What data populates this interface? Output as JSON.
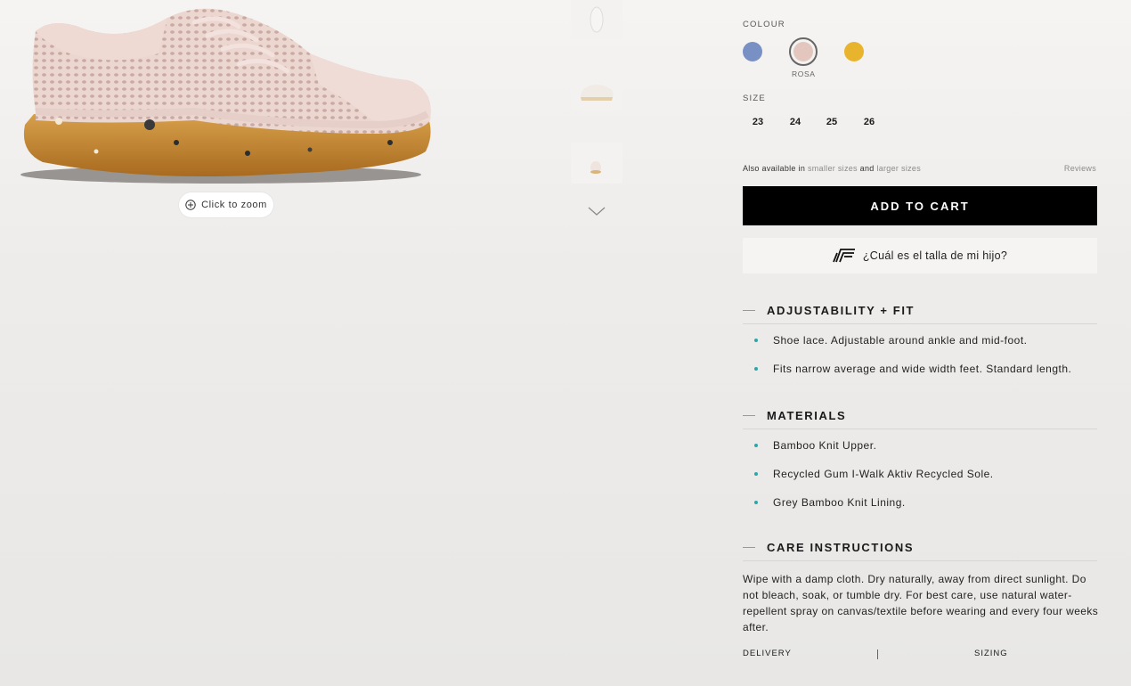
{
  "gallery": {
    "zoom_label": "Click to zoom"
  },
  "options": {
    "colour_label": "COLOUR",
    "colours": [
      {
        "name": "",
        "hex": "#7890c4"
      },
      {
        "name": "ROSA",
        "hex": "#e3c7bf",
        "selected": true
      },
      {
        "name": "",
        "hex": "#e9b42d"
      }
    ],
    "size_label": "SIZE",
    "sizes": [
      "23",
      "24",
      "25",
      "26"
    ]
  },
  "availability": {
    "prefix": "Also available in ",
    "smaller": "smaller sizes",
    "and": " and ",
    "larger": "larger sizes",
    "reviews": "Reviews"
  },
  "cta": {
    "add_to_cart": "ADD TO CART",
    "fit_finder": "¿Cuál es el talla de mi hijo?"
  },
  "sections": {
    "adjustability": {
      "title": "ADJUSTABILITY + FIT",
      "items": [
        "Shoe lace. Adjustable around ankle and mid-foot.",
        "Fits narrow average and wide width feet. Standard length."
      ]
    },
    "materials": {
      "title": "MATERIALS",
      "items": [
        "Bamboo Knit Upper.",
        "Recycled Gum I-Walk Aktiv Recycled Sole.",
        "Grey Bamboo Knit Lining."
      ]
    },
    "care": {
      "title": "CARE INSTRUCTIONS",
      "text": "Wipe with a damp cloth. Dry naturally, away from direct sunlight. Do not bleach, soak, or tumble dry. For best care, use natural water-repellent spray on canvas/textile before wearing and every four weeks after."
    }
  },
  "tabs": {
    "delivery": "DELIVERY",
    "sizing": "SIZING"
  },
  "colors": {
    "accent_bullet": "#2aa7a7",
    "button_bg": "#000000"
  }
}
